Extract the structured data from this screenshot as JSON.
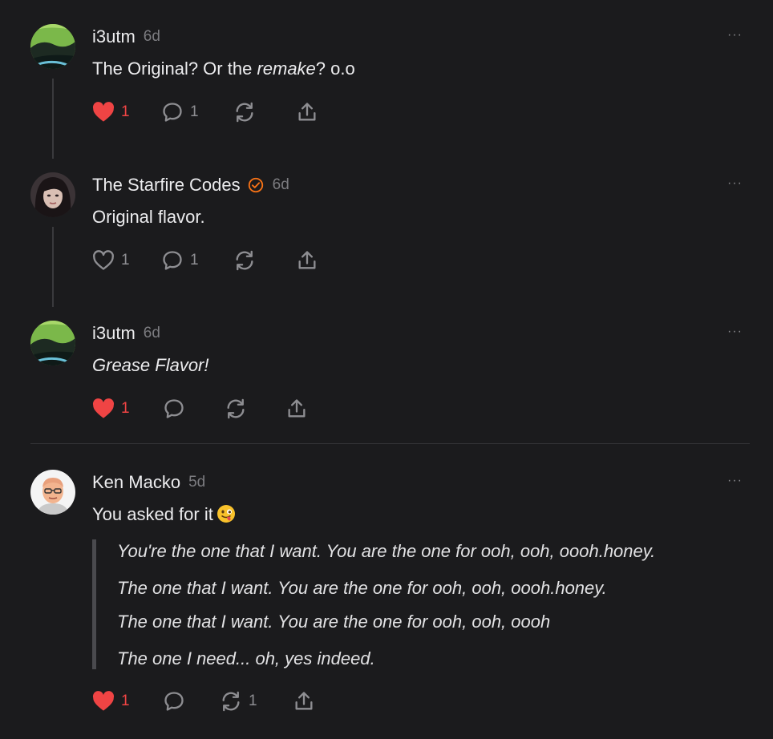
{
  "comments": [
    {
      "author": "i3utm",
      "time": "6d",
      "text_before": "The Original? Or the ",
      "text_em": "remake",
      "text_after": "? o.o",
      "likes": "1",
      "liked": true,
      "replies": "1",
      "restacks": "",
      "more": "···"
    },
    {
      "author": "The Starfire Codes",
      "verified": true,
      "time": "6d",
      "text": "Original flavor.",
      "likes": "1",
      "liked": false,
      "replies": "1",
      "restacks": "",
      "more": "···"
    },
    {
      "author": "i3utm",
      "time": "6d",
      "text": "Grease Flavor!",
      "likes": "1",
      "liked": true,
      "replies": "",
      "restacks": "",
      "more": "···"
    },
    {
      "author": "Ken Macko",
      "time": "5d",
      "text": "You asked for it",
      "emoji": "winking-face-with-tongue",
      "quote": [
        "You're the one that I want. You are the one for ooh, ooh, oooh.honey.",
        "The one that I want. You are the one for ooh, ooh, oooh.honey.",
        "The one that I want. You are the one for ooh, ooh, oooh",
        "The one I need... oh, yes indeed."
      ],
      "likes": "1",
      "liked": true,
      "replies": "",
      "restacks": "1",
      "more": "···"
    }
  ],
  "colors": {
    "background": "#1b1b1d",
    "like_active": "#ef4444",
    "verified_badge": "#f97316",
    "muted": "#7c7c80"
  },
  "icons": [
    "heart-icon",
    "comment-bubble-icon",
    "restack-icon",
    "share-icon",
    "more-options-icon",
    "verified-badge-icon"
  ]
}
